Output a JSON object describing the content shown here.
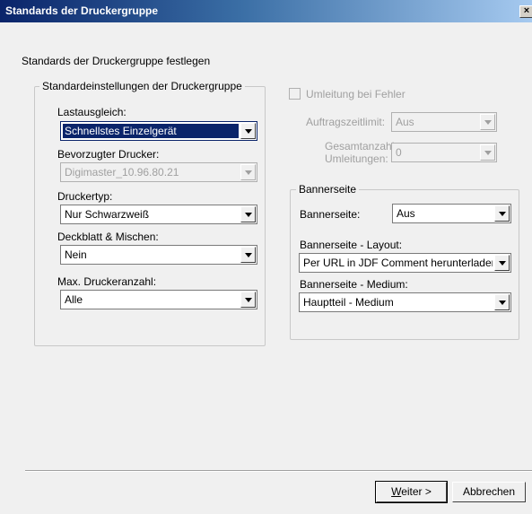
{
  "window": {
    "title": "Standards der Druckergruppe",
    "close_glyph": "×"
  },
  "page": {
    "heading": "Standards der Druckergruppe festlegen"
  },
  "left_group": {
    "legend": "Standardeinstellungen der Druckergruppe",
    "lastausgleich": {
      "label": "Lastausgleich:",
      "value": "Schnellstes Einzelgerät"
    },
    "bevorzugter_drucker": {
      "label": "Bevorzugter Drucker:",
      "value": "Digimaster_10.96.80.21"
    },
    "druckertyp": {
      "label": "Druckertyp:",
      "value": "Nur Schwarzweiß"
    },
    "deckblatt": {
      "label": "Deckblatt & Mischen:",
      "value": "Nein"
    },
    "max_druckeranzahl": {
      "label": "Max. Druckeranzahl:",
      "value": "Alle"
    }
  },
  "right_top": {
    "umleitung_checkbox": {
      "label": "Umleitung bei Fehler",
      "checked": false
    },
    "auftragszeitlimit": {
      "label": "Auftragszeitlimit:",
      "value": "Aus"
    },
    "gesamtanzahl": {
      "label_line1": "Gesamtanzahl",
      "label_line2": "Umleitungen:",
      "value": "0"
    }
  },
  "banner_group": {
    "legend": "Bannerseite",
    "bannerseite": {
      "label": "Bannerseite:",
      "value": "Aus"
    },
    "layout": {
      "label": "Bannerseite - Layout:",
      "value": "Per URL in JDF Comment herunterladen"
    },
    "medium": {
      "label": "Bannerseite - Medium:",
      "value": "Hauptteil - Medium"
    }
  },
  "buttons": {
    "weiter_first": "W",
    "weiter_rest": "eiter >",
    "abbrechen": "Abbrechen"
  }
}
